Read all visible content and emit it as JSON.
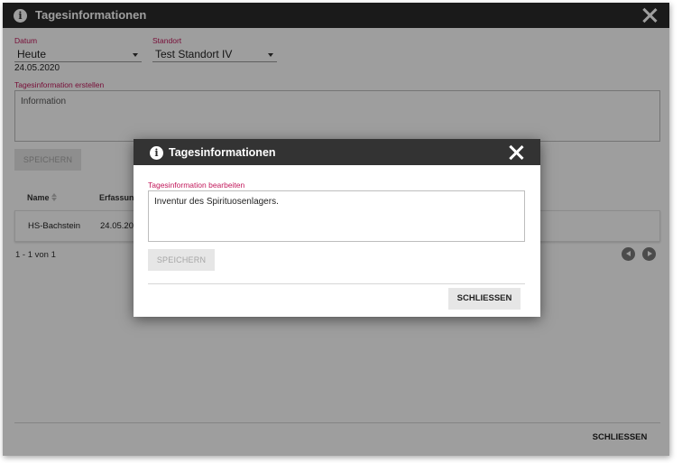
{
  "outer_dialog": {
    "title": "Tagesinformationen",
    "filters": {
      "date_label": "Datum",
      "date_value": "Heute",
      "date_text": "24.05.2020",
      "location_label": "Standort",
      "location_value": "Test Standort IV"
    },
    "create": {
      "label": "Tagesinformation erstellen",
      "placeholder": "Information",
      "save_label": "SPEICHERN"
    },
    "table": {
      "headers": [
        "Name",
        "Erfassung"
      ],
      "rows": [
        {
          "name": "HS-Bachstein",
          "date": "24.05.202"
        }
      ]
    },
    "pagination": {
      "text": "1 - 1 von 1"
    },
    "close_label": "SCHLIESSEN"
  },
  "modal": {
    "title": "Tagesinformationen",
    "edit_label": "Tagesinformation bearbeiten",
    "edit_value": "Inventur des Spirituosenlagers.",
    "save_label": "SPEICHERN",
    "close_label": "SCHLIESSEN"
  },
  "icons": {
    "info": "info-icon",
    "close": "close-icon",
    "dropdown": "chevron-down-icon",
    "sort": "sort-icon",
    "prev": "chevron-left-icon",
    "next": "chevron-right-icon"
  },
  "colors": {
    "titlebar": "#2b2b2b",
    "label_accent": "#c2185b",
    "disabled_button": "#e6e6e6"
  }
}
